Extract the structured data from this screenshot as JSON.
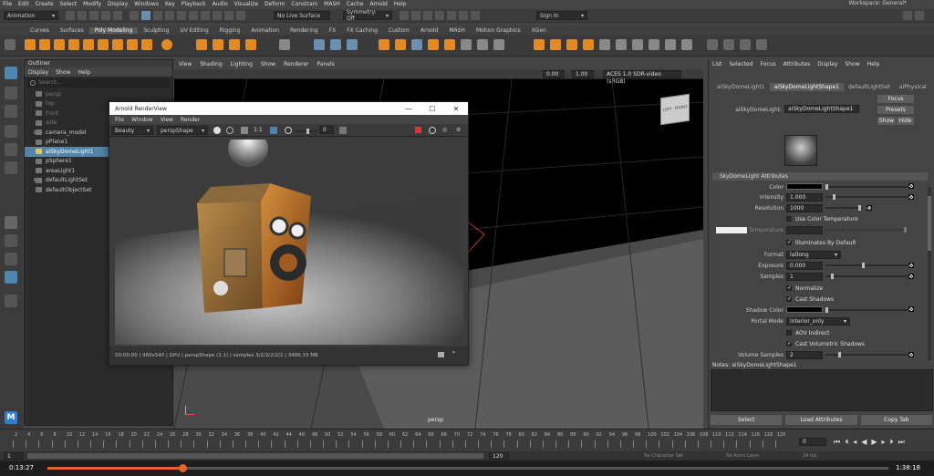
{
  "menubar": {
    "items": [
      "File",
      "Edit",
      "Create",
      "Select",
      "Modify",
      "Display",
      "Windows",
      "Key",
      "Playback",
      "Audio",
      "Visualize",
      "Deform",
      "Constrain",
      "MASH",
      "Cache",
      "Arnold",
      "Help"
    ],
    "workspace": "Workspace: General*"
  },
  "statusline": {
    "mode": "Animation",
    "live_surface": "No Live Surface",
    "symmetry": "Symmetry: Off",
    "sign_in": "Sign In"
  },
  "shelf_tabs": [
    "Curves",
    "Surfaces",
    "Poly Modeling",
    "Sculpting",
    "UV Editing",
    "Rigging",
    "Animation",
    "Rendering",
    "FX",
    "FX Caching",
    "Custom",
    "Arnold",
    "MASH",
    "Motion Graphics",
    "XGen"
  ],
  "shelf_active": "Poly Modeling",
  "outliner": {
    "title": "Outliner",
    "menu": [
      "Display",
      "Show",
      "Help"
    ],
    "search_placeholder": "Search...",
    "items": [
      {
        "label": "persp",
        "dim": true,
        "expand": false,
        "selected": false
      },
      {
        "label": "top",
        "dim": true,
        "expand": false,
        "selected": false
      },
      {
        "label": "front",
        "dim": true,
        "expand": false,
        "selected": false
      },
      {
        "label": "side",
        "dim": true,
        "expand": false,
        "selected": false
      },
      {
        "label": "camera_model",
        "dim": false,
        "expand": true,
        "selected": false
      },
      {
        "label": "pPlane1",
        "dim": false,
        "expand": false,
        "selected": false
      },
      {
        "label": "aiSkyDomeLight1",
        "dim": false,
        "expand": false,
        "selected": true
      },
      {
        "label": "pSphere1",
        "dim": false,
        "expand": false,
        "selected": false
      },
      {
        "label": "areaLight1",
        "dim": false,
        "expand": false,
        "selected": false
      },
      {
        "label": "defaultLightSet",
        "dim": false,
        "expand": true,
        "selected": false
      },
      {
        "label": "defaultObjectSet",
        "dim": false,
        "expand": false,
        "selected": false
      }
    ]
  },
  "viewport": {
    "menu": [
      "View",
      "Shading",
      "Lighting",
      "Show",
      "Renderer",
      "Panels"
    ],
    "field_a": "0.00",
    "field_b": "1.00",
    "colorspace": "ACES 1.0 SDR-video (sRGB)",
    "camera_label": "persp",
    "cube_left": "LEFT",
    "cube_front": "FRONT"
  },
  "renderview": {
    "title": "Arnold RenderView",
    "menu": [
      "File",
      "Window",
      "View",
      "Render"
    ],
    "aov": "Beauty",
    "camera": "perspShape",
    "ratio": "1:1",
    "exposure": "0",
    "status": "00:00:00 | 960x540 | GPU | perspShape (1:1) | samples 3/2/2/2/2/2 | 3486.33 MB",
    "minimize": "—",
    "maximize": "☐",
    "close": "✕"
  },
  "attribute_editor": {
    "menu": [
      "List",
      "Selected",
      "Focus",
      "Attributes",
      "Display",
      "Show",
      "Help"
    ],
    "tabs": [
      "aiSkyDomeLight1",
      "aiSkyDomeLightShape1",
      "defaultLightSet",
      "aiPhysical"
    ],
    "active_tab": "aiSkyDomeLightShape1",
    "node_label": "aiSkyDomeLight:",
    "node_value": "aiSkyDomeLightShape1",
    "focus_btn": "Focus",
    "presets_btn": "Presets",
    "show_btn": "Show",
    "hide_btn": "Hide",
    "section": "SkyDomeLight Attributes",
    "color_label": "Color",
    "intensity_label": "Intensity",
    "intensity_value": "1.000",
    "resolution_label": "Resolution",
    "resolution_value": "1000",
    "use_color_temp": "Use Color Temperature",
    "temperature_label": "Temperature",
    "illuminates": "Illuminates By Default",
    "format_label": "Format",
    "format_value": "latlong",
    "exposure_label": "Exposure",
    "exposure_value": "0.000",
    "samples_label": "Samples",
    "samples_value": "1",
    "normalize": "Normalize",
    "cast_shadows": "Cast Shadows",
    "shadow_color_label": "Shadow Color",
    "portal_mode_label": "Portal Mode",
    "portal_mode_value": "interior_only",
    "aov_indirect": "AOV Indirect",
    "cast_vol_shadows": "Cast Volumetric Shadows",
    "volume_samples_label": "Volume Samples",
    "volume_samples_value": "2",
    "notes": "Notes: aiSkyDomeLightShape1",
    "select_btn": "Select",
    "load_attr_btn": "Load Attributes",
    "copy_tab_btn": "Copy Tab"
  },
  "timeline": {
    "ticks": [
      "2",
      "4",
      "6",
      "8",
      "10",
      "12",
      "14",
      "16",
      "18",
      "20",
      "22",
      "24",
      "26",
      "28",
      "30",
      "32",
      "34",
      "36",
      "38",
      "40",
      "42",
      "44",
      "46",
      "48",
      "50",
      "52",
      "54",
      "56",
      "58",
      "60",
      "62",
      "64",
      "66",
      "68",
      "70",
      "72",
      "74",
      "76",
      "78",
      "80",
      "82",
      "84",
      "86",
      "88",
      "90",
      "92",
      "94",
      "96",
      "98",
      "100",
      "102",
      "104",
      "106",
      "108",
      "110",
      "112",
      "114",
      "116",
      "118",
      "120"
    ],
    "current_frame": "0",
    "range_start": "1",
    "range_end": "120",
    "no_char_set": "No Character Set",
    "no_anim_layer": "No Anim Layer",
    "fps": "24 fps"
  },
  "video": {
    "current_time": "0:13:27",
    "total_time": "1:38:18",
    "progress": 0.16
  },
  "colors": {
    "accent": "#5285a6",
    "progress": "#e8632b"
  }
}
